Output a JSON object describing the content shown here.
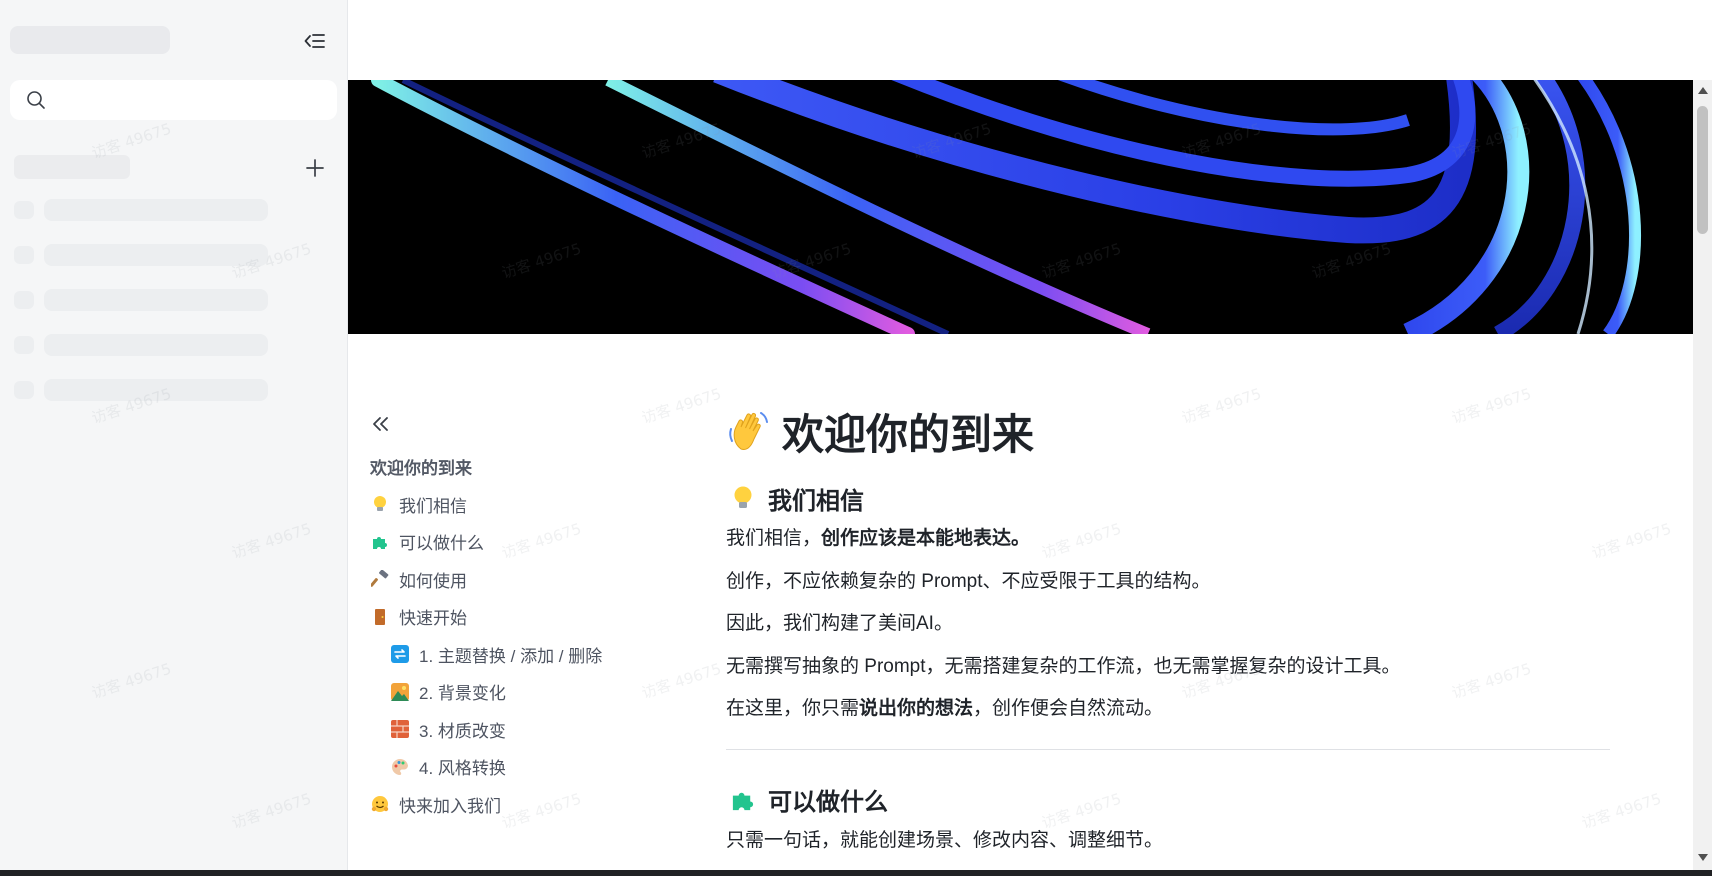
{
  "sidebar": {
    "search": {
      "placeholder": "",
      "value": ""
    },
    "collapse_icon": "sidebar-collapse-icon",
    "add_icon": "plus-icon",
    "skeleton_rows": 5
  },
  "outline": {
    "collapse_icon": "double-chevron-left-icon",
    "items": [
      {
        "label": "欢迎你的到来",
        "level": 1,
        "icon": ""
      },
      {
        "label": "我们相信",
        "level": 2,
        "icon": "light-bulb-icon"
      },
      {
        "label": "可以做什么",
        "level": 2,
        "icon": "puzzle-piece-icon"
      },
      {
        "label": "如何使用",
        "level": 2,
        "icon": "hammer-icon"
      },
      {
        "label": "快速开始",
        "level": 2,
        "icon": "door-icon"
      },
      {
        "label": "1. 主题替换 / 添加 / 删除",
        "level": 3,
        "icon": "repeat-arrows-icon"
      },
      {
        "label": "2. 背景变化",
        "level": 3,
        "icon": "landscape-icon"
      },
      {
        "label": "3. 材质改变",
        "level": 3,
        "icon": "brick-icon"
      },
      {
        "label": "4. 风格转换",
        "level": 3,
        "icon": "palette-icon"
      },
      {
        "label": "快来加入我们",
        "level": 2,
        "icon": "hugging-face-icon"
      }
    ]
  },
  "document": {
    "title": "欢迎你的到来",
    "title_icon": "waving-hand-icon",
    "section1": {
      "heading": "我们相信",
      "heading_icon": "light-bulb-icon",
      "p1_prefix": "我们相信，",
      "p1_bold": "创作应该是本能地表达。",
      "p2": "创作，不应依赖复杂的 Prompt、不应受限于工具的结构。",
      "p3": "因此，我们构建了美间AI。",
      "p4": "无需撰写抽象的 Prompt，无需搭建复杂的工作流，也无需掌握复杂的设计工具。",
      "p5_prefix": "在这里，你只需",
      "p5_bold": "说出你的想法",
      "p5_suffix": "，创作便会自然流动。"
    },
    "section2": {
      "heading": "可以做什么",
      "heading_icon": "puzzle-piece-icon",
      "p1": "只需一句话，就能创建场景、修改内容、调整细节。"
    }
  },
  "watermark": "访客 49675",
  "colors": {
    "sidebar_bg": "#f5f6f7",
    "skeleton": "#eceef0",
    "cover_bg": "#000000",
    "ribbon_blue": "#2f4ef0",
    "ribbon_cyan": "#7de8e0"
  }
}
